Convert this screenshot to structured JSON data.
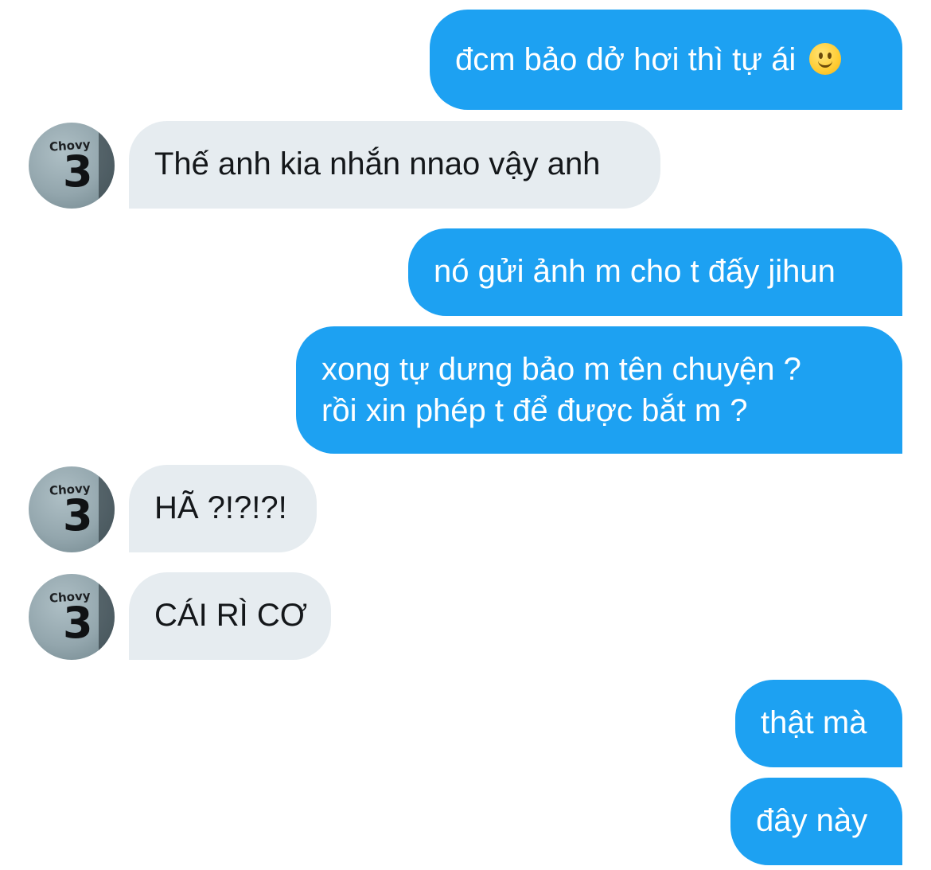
{
  "contact": {
    "avatar_name": "Chovy",
    "avatar_number": "3"
  },
  "messages": [
    {
      "direction": "outgoing",
      "text": "đcm bảo dở hơi thì tự ái",
      "emoji": "slightly-smiling-face-icon"
    },
    {
      "direction": "incoming",
      "text": "Thế anh kia nhắn nnao vậy anh"
    },
    {
      "direction": "outgoing",
      "text": "nó gửi ảnh m cho t đấy jihun"
    },
    {
      "direction": "outgoing",
      "lines": [
        "xong tự dưng bảo m tên chuyện ?",
        "rồi xin phép t để được bắt m ?"
      ]
    },
    {
      "direction": "incoming",
      "text": "HÃ ?!?!?!"
    },
    {
      "direction": "incoming",
      "text": "CÁI RÌ CƠ"
    },
    {
      "direction": "outgoing",
      "text": "thật mà"
    },
    {
      "direction": "outgoing",
      "text": "đây này"
    }
  ],
  "colors": {
    "outgoing_bubble": "#1da1f2",
    "incoming_bubble": "#e6ecf0",
    "incoming_text": "#14171a",
    "outgoing_text": "#ffffff"
  }
}
